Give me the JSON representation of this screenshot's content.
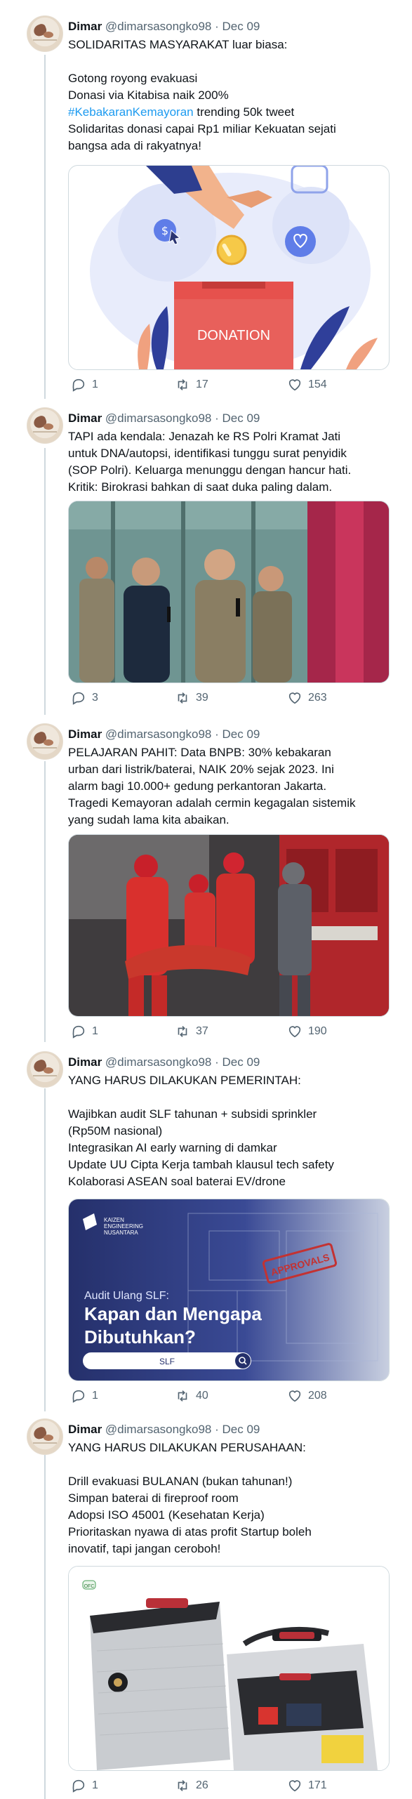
{
  "tweets": [
    {
      "name": "Dimar",
      "handle": "@dimarsasongko98",
      "sep": "·",
      "date": "Dec 09",
      "lines": [
        "SOLIDARITAS MASYARAKAT luar biasa:",
        "",
        "Gotong royong evakuasi",
        "Donasi via Kitabisa naik 200%"
      ],
      "hashtag": "#KebakaranKemayoran",
      "hashtag_rest": " trending 50k tweet",
      "lines2": [
        "Solidaritas donasi capai Rp1 miliar Kekuatan sejati",
        "bangsa ada di rakyatnya!"
      ],
      "media_label": "DONATION",
      "replies": "1",
      "reposts": "17",
      "likes": "154"
    },
    {
      "name": "Dimar",
      "handle": "@dimarsasongko98",
      "sep": "·",
      "date": "Dec 09",
      "lines": [
        "TAPI ada kendala: Jenazah ke RS Polri Kramat Jati",
        "untuk DNA/autopsi, identifikasi tunggu surat penyidik",
        "(SOP Polri). Keluarga menunggu dengan hancur hati.",
        "Kritik: Birokrasi bahkan di saat duka paling dalam."
      ],
      "replies": "3",
      "reposts": "39",
      "likes": "263"
    },
    {
      "name": "Dimar",
      "handle": "@dimarsasongko98",
      "sep": "·",
      "date": "Dec 09",
      "lines": [
        "PELAJARAN PAHIT: Data BNPB: 30% kebakaran",
        "urban dari listrik/baterai, NAIK 20% sejak 2023. Ini",
        "alarm bagi 10.000+ gedung perkantoran Jakarta.",
        "Tragedi Kemayoran adalah cermin kegagalan sistemik",
        "yang sudah lama kita abaikan."
      ],
      "replies": "1",
      "reposts": "37",
      "likes": "190"
    },
    {
      "name": "Dimar",
      "handle": "@dimarsasongko98",
      "sep": "·",
      "date": "Dec 09",
      "lines": [
        "YANG HARUS DILAKUKAN PEMERINTAH:",
        "",
        "Wajibkan audit SLF tahunan + subsidi sprinkler",
        "(Rp50M nasional)",
        "Integrasikan AI early warning di damkar",
        "Update UU Cipta Kerja tambah klausul tech safety",
        "Kolaborasi ASEAN soal baterai EV/drone"
      ],
      "media": {
        "brand_line1": "KAIZEN",
        "brand_line2": "ENGINEERING",
        "brand_line3": "NUSANTARA",
        "kicker": "Audit Ulang SLF:",
        "title1": "Kapan dan Mengapa",
        "title2": "Dibutuhkan?",
        "search_text": "SLF",
        "stamp": "APPROVALS"
      },
      "replies": "1",
      "reposts": "40",
      "likes": "208"
    },
    {
      "name": "Dimar",
      "handle": "@dimarsasongko98",
      "sep": "·",
      "date": "Dec 09",
      "lines": [
        "YANG HARUS DILAKUKAN PERUSAHAAN:",
        "",
        "Drill evakuasi BULANAN (bukan tahunan!)",
        "Simpan baterai di fireproof room",
        "Adopsi ISO 45001 (Kesehatan Kerja)",
        "Prioritaskan nyawa di atas profit Startup boleh",
        "inovatif, tapi jangan ceroboh!"
      ],
      "media_badge": "OFC",
      "replies": "1",
      "reposts": "26",
      "likes": "171"
    }
  ],
  "colors": {
    "accent": "#1d9bf0",
    "muted": "#536471",
    "border": "#cfd9de"
  }
}
